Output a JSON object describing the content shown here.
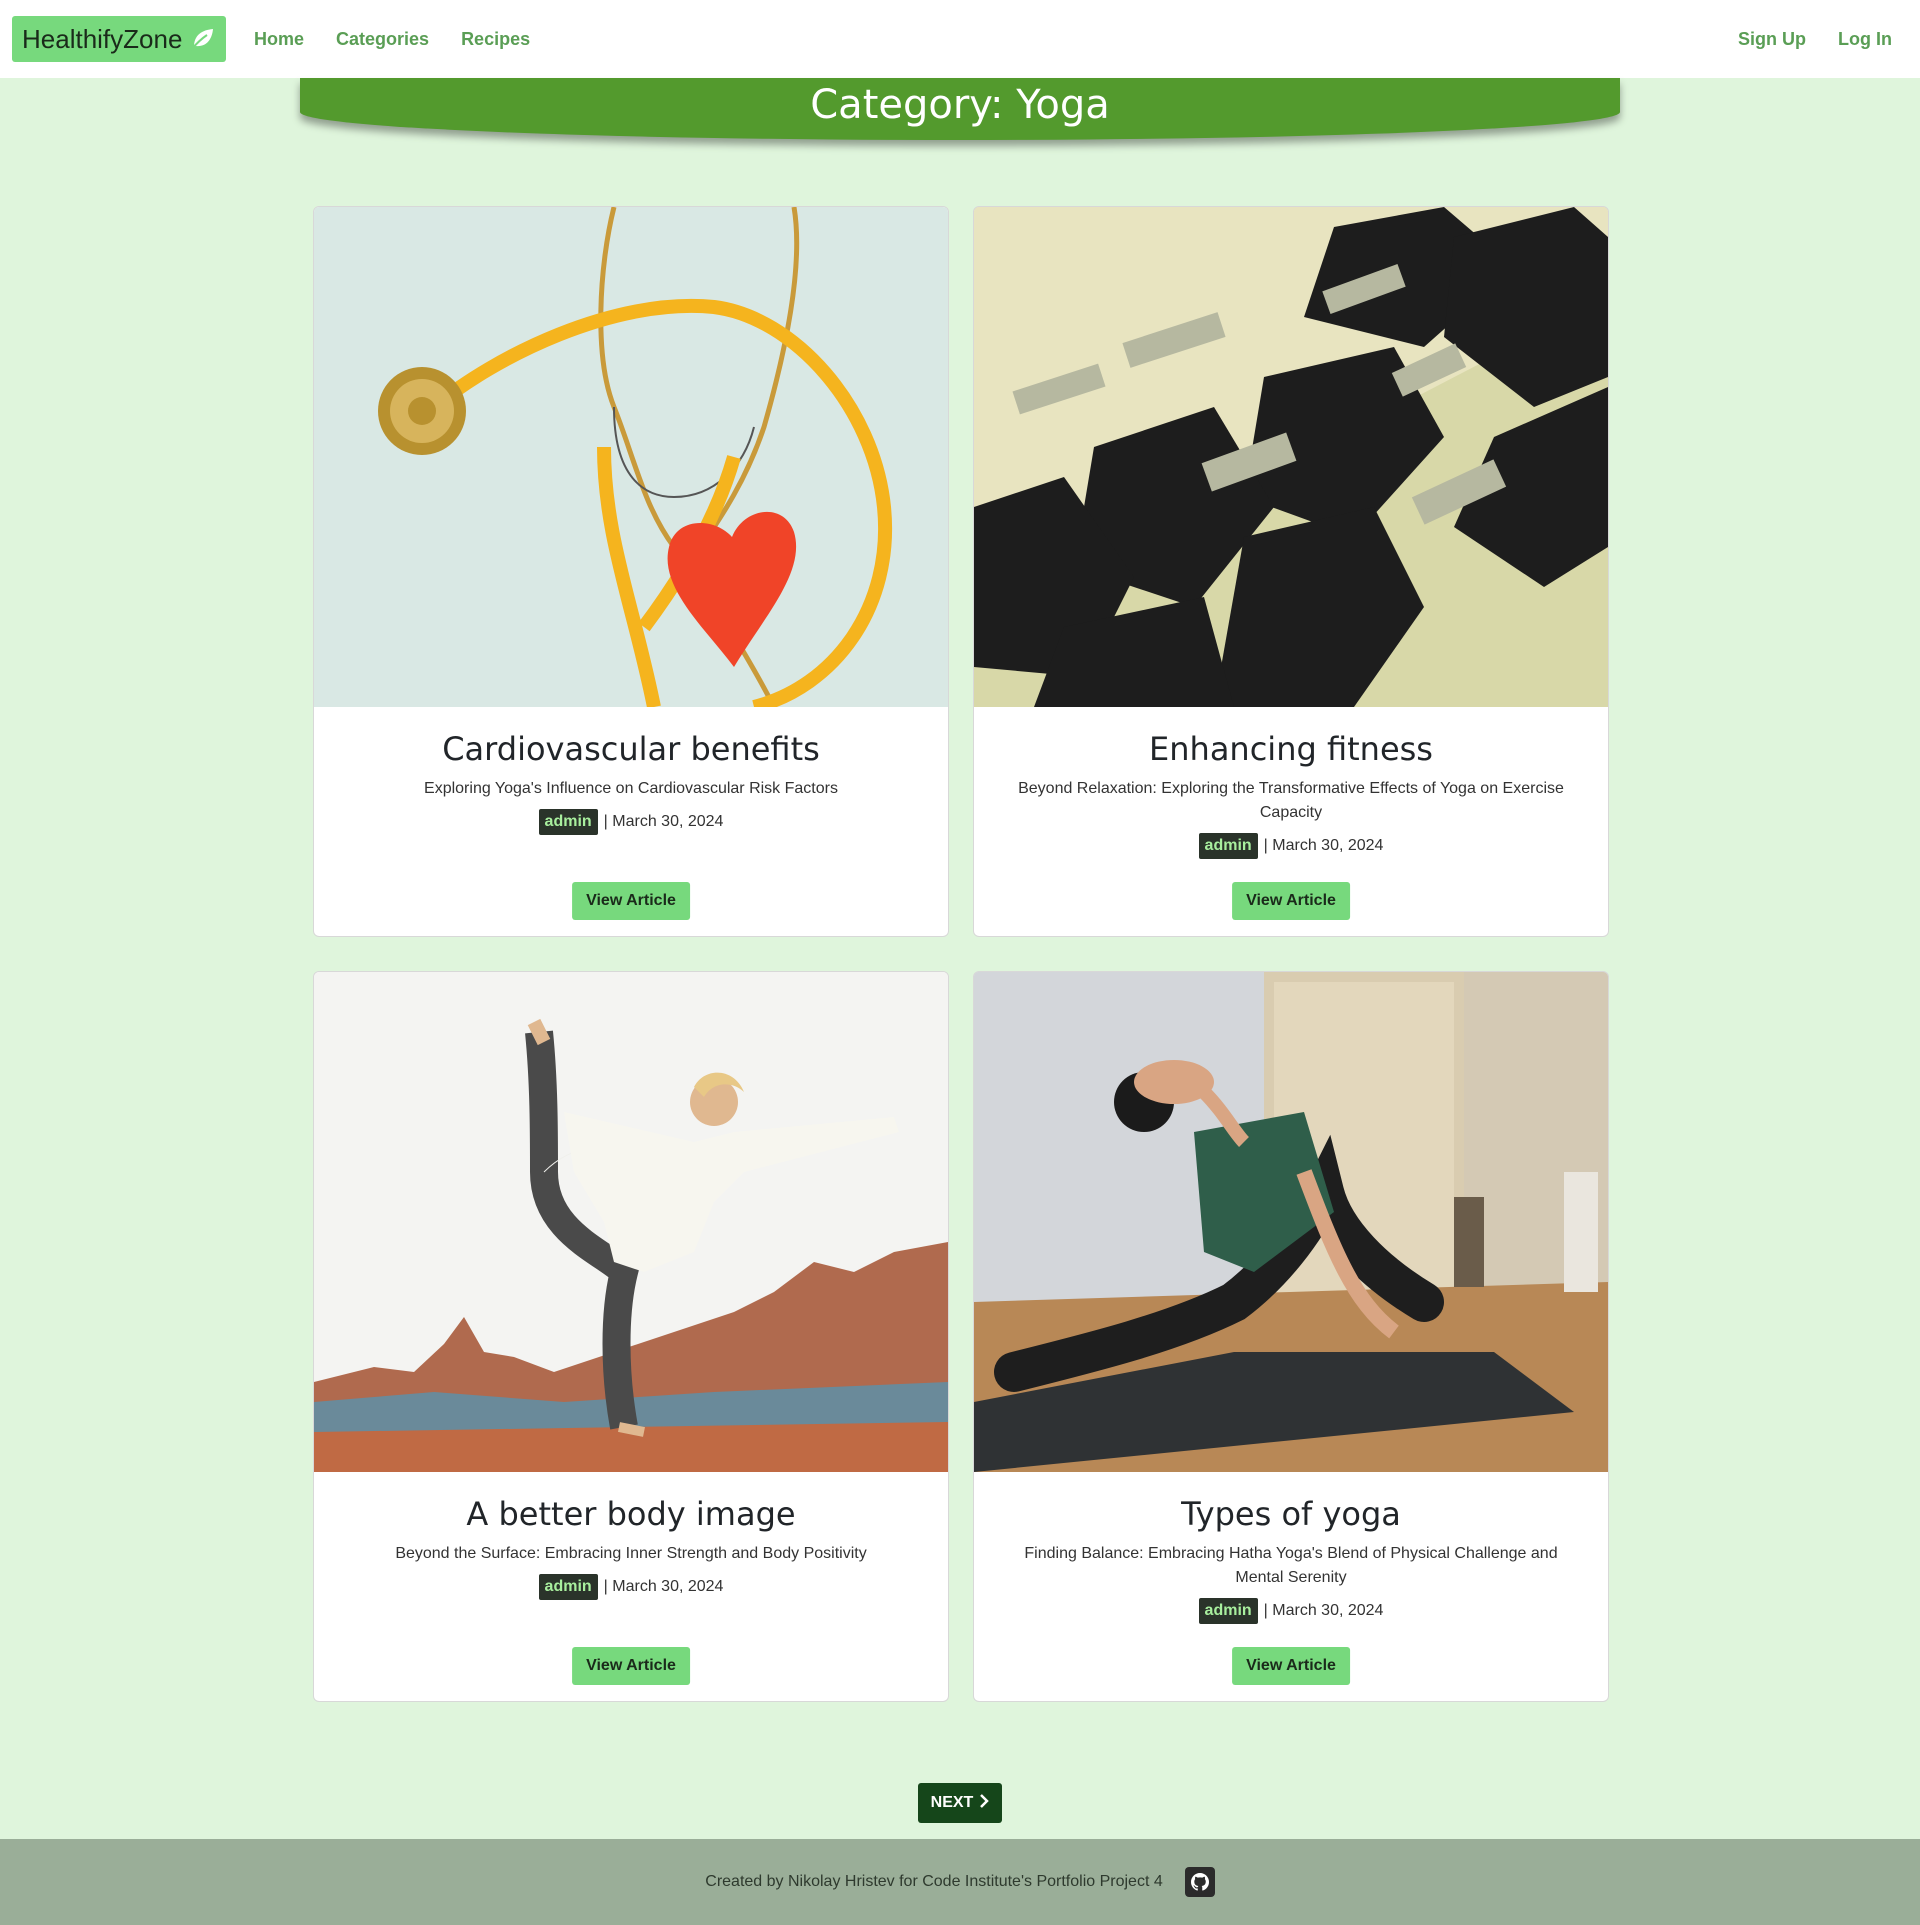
{
  "brand": {
    "name": "HealthifyZone"
  },
  "nav": {
    "home": "Home",
    "categories": "Categories",
    "recipes": "Recipes",
    "signup": "Sign Up",
    "login": "Log In"
  },
  "page": {
    "title": "Category: Yoga"
  },
  "articles": [
    {
      "title": "Cardiovascular benefits",
      "subtitle": "Exploring Yoga's Influence on Cardiovascular Risk Factors",
      "author": "admin",
      "date": "| March 30, 2024",
      "button": "View Article",
      "image": "stethoscope-heart-image"
    },
    {
      "title": "Enhancing fitness",
      "subtitle": "Beyond Relaxation: Exploring the Transformative Effects of Yoga on Exercise Capacity",
      "author": "admin",
      "date": "| March 30, 2024",
      "button": "View Article",
      "image": "dumbbells-image"
    },
    {
      "title": "A better body image",
      "subtitle": "Beyond the Surface: Embracing Inner Strength and Body Positivity",
      "author": "admin",
      "date": "| March 30, 2024",
      "button": "View Article",
      "image": "yoga-pose-desert-image"
    },
    {
      "title": "Types of yoga",
      "subtitle": "Finding Balance: Embracing Hatha Yoga's Blend of Physical Challenge and Mental Serenity",
      "author": "admin",
      "date": "| March 30, 2024",
      "button": "View Article",
      "image": "cobra-pose-image"
    }
  ],
  "pagination": {
    "next": "NEXT"
  },
  "footer": {
    "text": "Created by Nikolay Hristev for Code Institute's Portfolio Project 4"
  },
  "colors": {
    "page_bg": "#dff5dc",
    "brand_bg": "#77d97d",
    "banner": "#539a2d",
    "nav_link": "#5a9e55",
    "next_btn": "#15461a",
    "footer_bg": "#9aae98"
  }
}
